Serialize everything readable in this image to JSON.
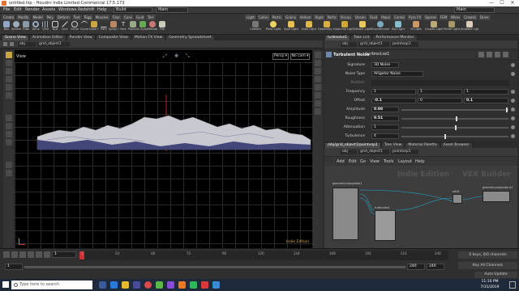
{
  "window": {
    "title": "untitled.hip - Houdini Indie Limited-Commercial 17.5.173",
    "min": "—",
    "max": "☐",
    "close": "✕"
  },
  "menu": {
    "items": [
      "File",
      "Edit",
      "Render",
      "Assets",
      "Windows",
      "Redshift",
      "Help"
    ],
    "build": "Build",
    "main": "Main",
    "main_right": "Main"
  },
  "shelf": {
    "tabs_left": [
      "Create",
      "Modify",
      "Model",
      "Poly",
      "Deform",
      "Text",
      "Rigg",
      "Muscles",
      "Char",
      "Cons",
      "Guid",
      "Terr"
    ],
    "tools_left": [
      "Box",
      "Sphere",
      "Tube",
      "Torus",
      "Grid",
      "Null",
      "Line",
      "Circle",
      "Curve",
      "Draw Curve",
      "Path",
      "Spray Paint",
      "Font",
      "Platonic Solids",
      "L-System",
      "Metaball",
      "File"
    ],
    "tabs_right": [
      "Light",
      "Collisi",
      "Partic",
      "Grains",
      "Vellum",
      "Rigid",
      "Partic",
      "Viscou",
      "Ocean",
      "Fluid",
      "Popul",
      "Contai",
      "Pyro FX",
      "Sparse",
      "FEM",
      "Wires",
      "Crowds",
      "Drive"
    ],
    "tools_right": [
      "Camera",
      "Point Light",
      "Spot Light",
      "Area Light",
      "Geometry Light",
      "Volume Light",
      "Distant Light",
      "Environment Light",
      "Sky Light",
      "GI Light",
      "Caustic Light",
      "Portal Light",
      "Ambient Light"
    ]
  },
  "left_tabs": [
    "Scene View",
    "Animation Editor",
    "Render View",
    "Composite View",
    "Motion FX View",
    "Geometry Spreadsheet"
  ],
  "left_path": [
    "obj",
    "grid_object1"
  ],
  "viewport": {
    "label": "View",
    "persp": "Persp ▾",
    "cam": "No cam ▾",
    "badge": "Indie Edition"
  },
  "right_tabs": [
    "turbnoise1",
    "Take List",
    "Performance Monitor"
  ],
  "right_path": [
    "obj",
    "grid_object1",
    "pointvop1"
  ],
  "param_header": {
    "type": "Turbulent Noise",
    "name": "turbnoise1"
  },
  "params": [
    {
      "label": "Signature",
      "value": "3D Noise"
    },
    {
      "label": "Noise Type",
      "value": "Alligator Noise"
    },
    {
      "label": "Position",
      "value": ""
    },
    {
      "label": "Frequency",
      "value": "1",
      "v2": "1",
      "v3": "1"
    },
    {
      "label": "Offset",
      "value": "-0.1",
      "v2": "0",
      "v3": "0.1"
    },
    {
      "label": "Amplitude",
      "value": "0.98",
      "level": 0.98
    },
    {
      "label": "Roughness",
      "value": "0.51",
      "level": 0.51
    },
    {
      "label": "Attenuation",
      "value": "1",
      "level": 0.5
    },
    {
      "label": "Turbulence",
      "value": "4",
      "level": 0.4
    }
  ],
  "net_tabs": [
    "/obj/grid_object1/pointvop1",
    "Tree View",
    "Material Palette",
    "Asset Browser"
  ],
  "net_path": [
    "obj",
    "grid_object1",
    "pointvop1"
  ],
  "net_menu": [
    "Add",
    "Edit",
    "Go",
    "View",
    "Tools",
    "Layout",
    "Help"
  ],
  "network": {
    "watermark_left": "Indie Edition",
    "watermark_right": "VEX Builder",
    "nodes": [
      "geometryvopglobal1",
      "turbnoise1",
      "add1",
      "geometryvopoutput1"
    ]
  },
  "timeline": {
    "frame": "1",
    "start": "1",
    "end": "240",
    "end2": "240",
    "ticks": [
      "1",
      "24",
      "48",
      "72",
      "96",
      "120",
      "144",
      "168",
      "192",
      "216",
      "240"
    ],
    "keys": "0 keys, 0/0 channels",
    "keyall": "Key All Channels",
    "auto": "Auto Update"
  },
  "taskbar": {
    "search": "Type here to search",
    "time": "11:10 PM",
    "date": "7/31/2019"
  },
  "colors": {
    "accent": "#e8732a",
    "viewport_bg": "#000000",
    "terrain": "#c8c8d0",
    "terrain_dark": "#2a2f6a"
  }
}
